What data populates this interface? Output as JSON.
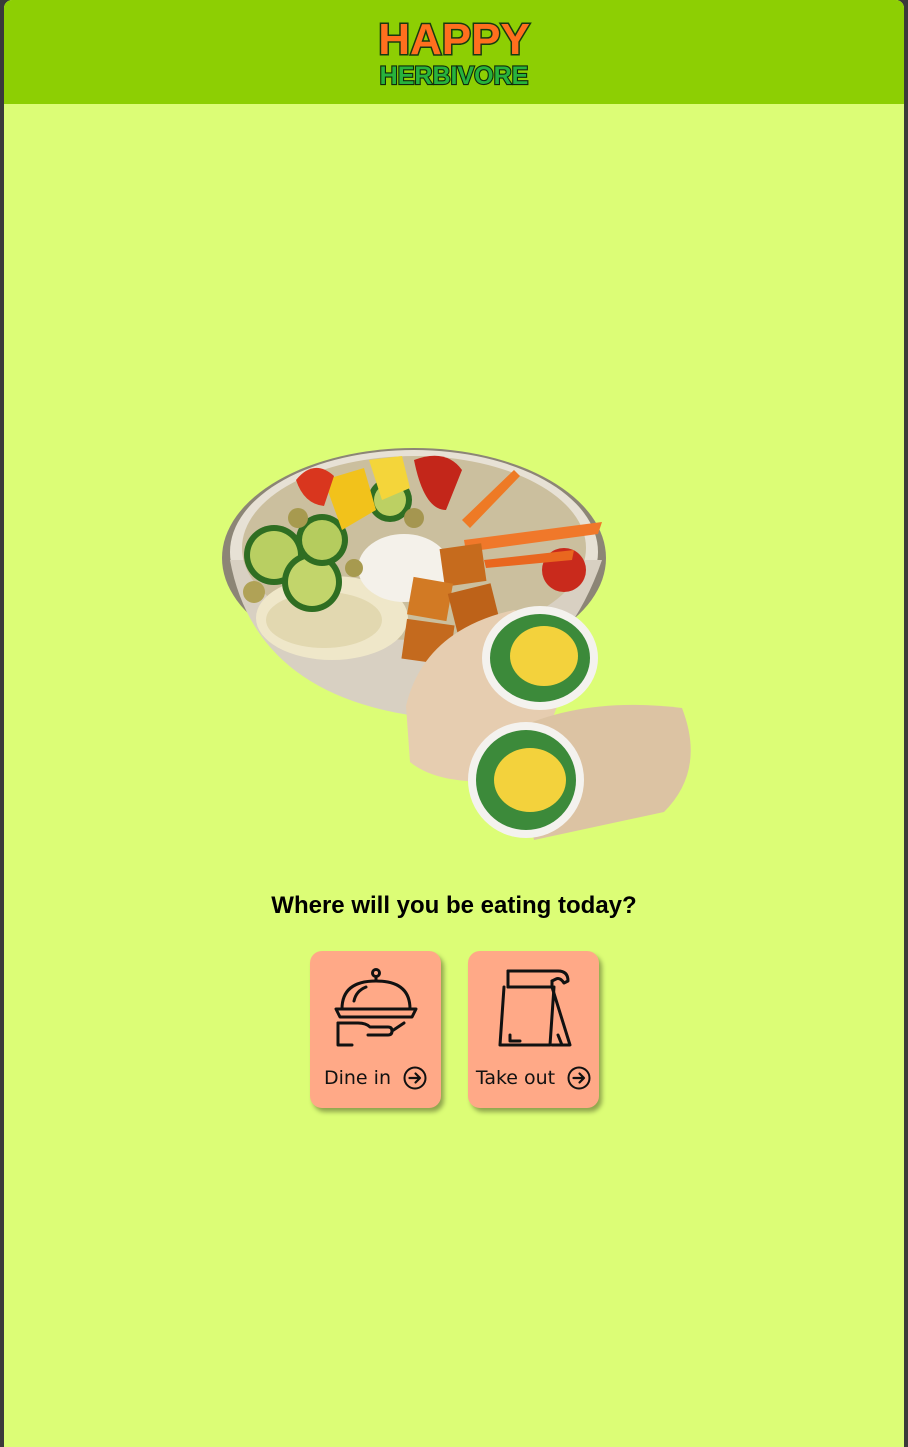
{
  "header": {
    "logo_line1": "HAPPY",
    "logo_line2": "HERBIVORE",
    "logo_color_primary": "#ff6f1e",
    "logo_color_secondary": "#1b9a2f"
  },
  "hero": {
    "icon": "food-bowl-and-wraps-image"
  },
  "main": {
    "question": "Where will you be eating today?",
    "options": [
      {
        "label": "Dine in",
        "icon": "serving-cloche-icon"
      },
      {
        "label": "Take out",
        "icon": "takeout-bag-icon"
      }
    ]
  },
  "colors": {
    "header_bg": "#8dcf03",
    "page_bg": "#dcfd76",
    "card_bg": "#ffa987"
  }
}
